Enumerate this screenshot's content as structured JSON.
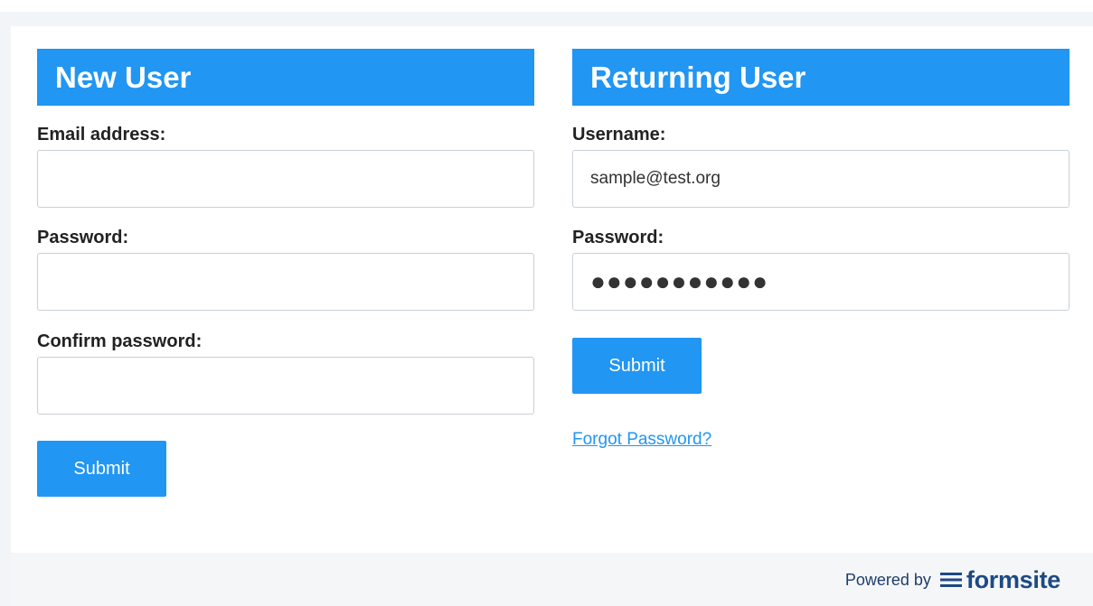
{
  "new_user": {
    "title": "New User",
    "email_label": "Email address:",
    "email_value": "",
    "password_label": "Password:",
    "password_value": "",
    "confirm_label": "Confirm password:",
    "confirm_value": "",
    "submit_label": "Submit"
  },
  "returning_user": {
    "title": "Returning User",
    "username_label": "Username:",
    "username_value": "sample@test.org",
    "password_label": "Password:",
    "password_masked": "●●●●●●●●●●●",
    "submit_label": "Submit",
    "forgot_link": "Forgot Password?"
  },
  "footer": {
    "powered_by": "Powered by",
    "brand": "formsite",
    "brand_icon": "lines-icon"
  },
  "colors": {
    "accent": "#2196f3",
    "brand": "#1d4a84"
  }
}
